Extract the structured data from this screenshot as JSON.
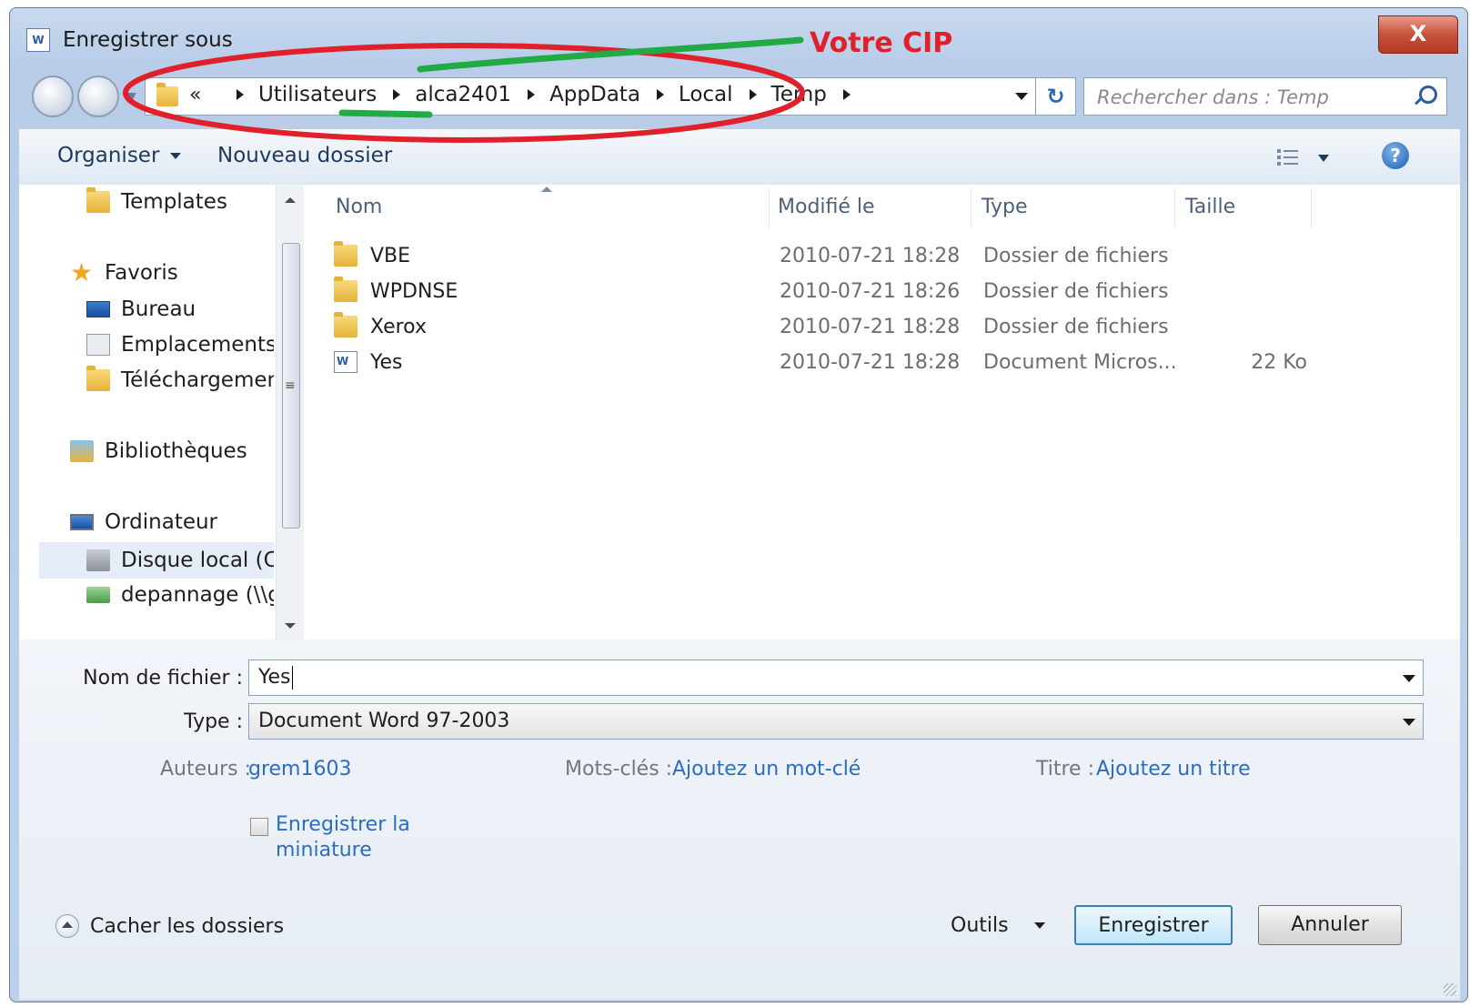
{
  "window": {
    "title": "Enregistrer sous",
    "close_label": "X"
  },
  "address": {
    "overflow": "«",
    "crumbs": [
      "Utilisateurs",
      "alca2401",
      "AppData",
      "Local",
      "Temp"
    ]
  },
  "annotation": {
    "text": "Votre CIP",
    "color": "#e0202a"
  },
  "search": {
    "placeholder": "Rechercher dans : Temp"
  },
  "toolbar": {
    "organize": "Organiser",
    "new_folder": "Nouveau dossier",
    "help": "?"
  },
  "nav": {
    "items": [
      {
        "label": "Templates"
      },
      {
        "label": "Favoris"
      },
      {
        "label": "Bureau"
      },
      {
        "label": "Emplacements ré"
      },
      {
        "label": "Téléchargements"
      },
      {
        "label": "Bibliothèques"
      },
      {
        "label": "Ordinateur"
      },
      {
        "label": "Disque local (C:)"
      },
      {
        "label": "depannage (\\\\ge"
      }
    ]
  },
  "columns": {
    "name": "Nom",
    "modified": "Modifié le",
    "type": "Type",
    "size": "Taille"
  },
  "files": [
    {
      "name": "VBE",
      "modified": "2010-07-21 18:28",
      "type": "Dossier de fichiers",
      "size": "",
      "kind": "folder"
    },
    {
      "name": "WPDNSE",
      "modified": "2010-07-21 18:26",
      "type": "Dossier de fichiers",
      "size": "",
      "kind": "folder"
    },
    {
      "name": "Xerox",
      "modified": "2010-07-21 18:28",
      "type": "Dossier de fichiers",
      "size": "",
      "kind": "folder"
    },
    {
      "name": "Yes",
      "modified": "2010-07-21 18:28",
      "type": "Document Micros...",
      "size": "22 Ko",
      "kind": "document"
    }
  ],
  "form": {
    "filename_label": "Nom de fichier :",
    "filename_value": "Yes",
    "type_label": "Type :",
    "type_value": "Document Word 97-2003",
    "authors_label": "Auteurs :",
    "authors_value": "grem1603",
    "keywords_label": "Mots-clés :",
    "keywords_value": "Ajoutez un mot-clé",
    "title_label": "Titre :",
    "title_value": "Ajoutez un titre",
    "thumbnail_label_line1": "Enregistrer la",
    "thumbnail_label_line2": "miniature"
  },
  "footer": {
    "hide_folders": "Cacher les dossiers",
    "tools": "Outils",
    "save": "Enregistrer",
    "cancel": "Annuler"
  }
}
